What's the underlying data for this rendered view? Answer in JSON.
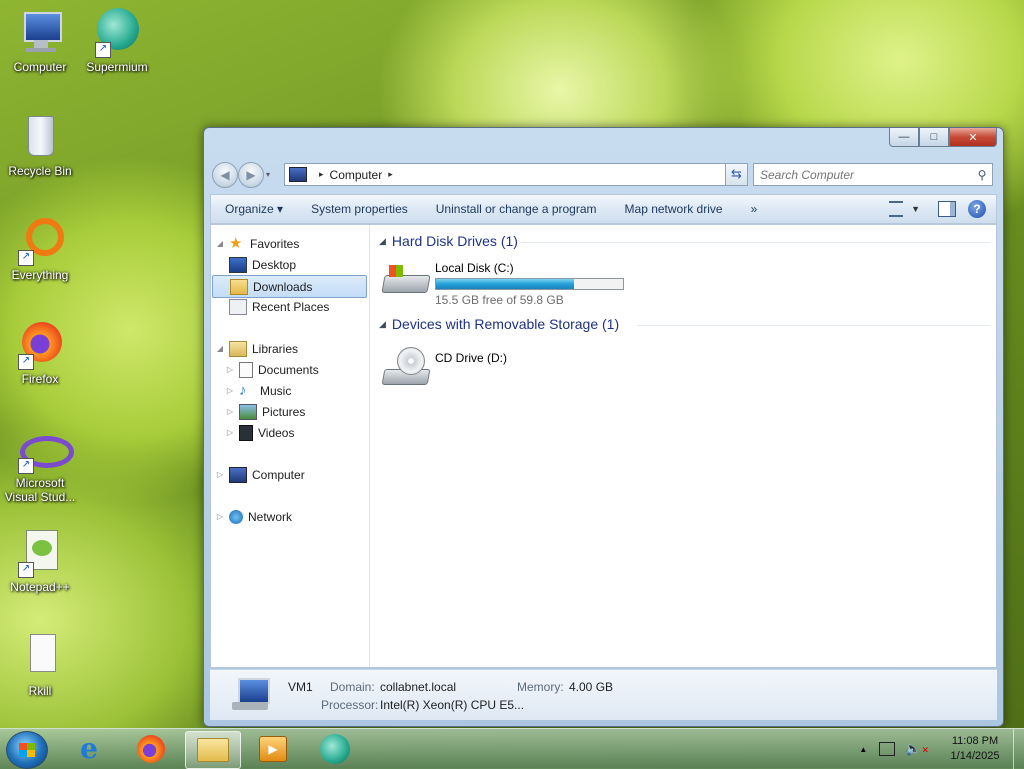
{
  "desktop": {
    "icons": [
      {
        "label": "Computer"
      },
      {
        "label": "Supermium"
      },
      {
        "label": "Recycle Bin"
      },
      {
        "label": "Everything"
      },
      {
        "label": "Firefox"
      },
      {
        "label": "Microsoft Visual Stud..."
      },
      {
        "label": "Notepad++"
      },
      {
        "label": "Rkill"
      }
    ]
  },
  "window": {
    "caption": {
      "minimize": "—",
      "maximize": "□",
      "close": "✕"
    },
    "address": {
      "crumb": "Computer",
      "sep1": "▸",
      "sep2": "▸"
    },
    "search": {
      "placeholder": "Search Computer"
    },
    "toolbar": {
      "organize": "Organize ▾",
      "system_properties": "System properties",
      "uninstall": "Uninstall or change a program",
      "map_drive": "Map network drive",
      "more": "»",
      "help": "?"
    },
    "navpane": {
      "favorites": "Favorites",
      "desktop": "Desktop",
      "downloads": "Downloads",
      "recent": "Recent Places",
      "libraries": "Libraries",
      "documents": "Documents",
      "music": "Music",
      "pictures": "Pictures",
      "videos": "Videos",
      "computer": "Computer",
      "network": "Network"
    },
    "groups": {
      "hdd": "Hard Disk Drives (1)",
      "removable": "Devices with Removable Storage (1)"
    },
    "drives": {
      "c": {
        "label": "Local Disk (C:)",
        "free": "15.5 GB free of 59.8 GB",
        "used_fraction": 0.74
      },
      "d": {
        "label": "CD Drive (D:)"
      }
    },
    "details": {
      "name": "VM1",
      "domain_label": "Domain:",
      "domain": "collabnet.local",
      "memory_label": "Memory:",
      "memory": "4.00 GB",
      "processor_label": "Processor:",
      "processor": "Intel(R) Xeon(R) CPU E5..."
    }
  },
  "taskbar": {
    "clock_time": "11:08 PM",
    "clock_date": "1/14/2025",
    "show_hidden": "▲"
  }
}
